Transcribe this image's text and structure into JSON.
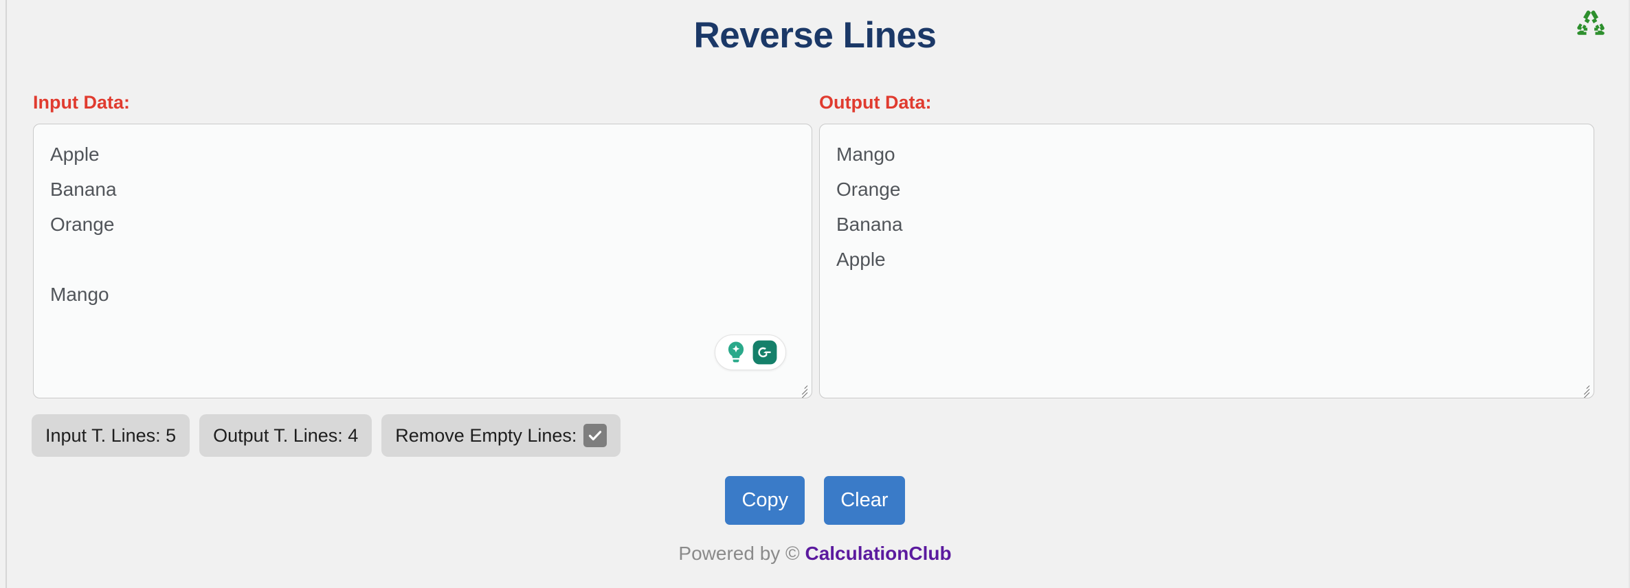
{
  "header": {
    "title": "Reverse Lines",
    "title_color": "#1b3867",
    "recycle_icon": "recycle-icon",
    "recycle_color": "#2d8f2d"
  },
  "panels": {
    "input": {
      "label": "Input Data:",
      "lines": [
        "Apple",
        "Banana",
        "Orange",
        "",
        "Mango"
      ],
      "text": "Apple\nBanana\nOrange\n\nMango"
    },
    "output": {
      "label": "Output Data:",
      "lines": [
        "Mango",
        "Orange",
        "Banana",
        "Apple"
      ],
      "text": "Mango\nOrange\nBanana\nApple"
    },
    "label_color": "#e03b2f"
  },
  "extension": {
    "name": "grammarly-widget",
    "bulb_icon": "lightbulb-sparkle-icon",
    "logo_icon": "grammarly-g-icon",
    "logo_color": "#15806a"
  },
  "badges": [
    {
      "label": "Input T. Lines:",
      "value": "5",
      "text": "Input T. Lines: 5"
    },
    {
      "label": "Output T. Lines:",
      "value": "4",
      "text": "Output T. Lines: 4"
    }
  ],
  "remove_empty_lines": {
    "label": "Remove Empty Lines:",
    "checked": true
  },
  "actions": {
    "copy_label": "Copy",
    "clear_label": "Clear",
    "button_color": "#3a7bc8"
  },
  "footer": {
    "prefix": "Powered by © ",
    "brand": "CalculationClub",
    "brand_color": "#5b1a9e"
  }
}
